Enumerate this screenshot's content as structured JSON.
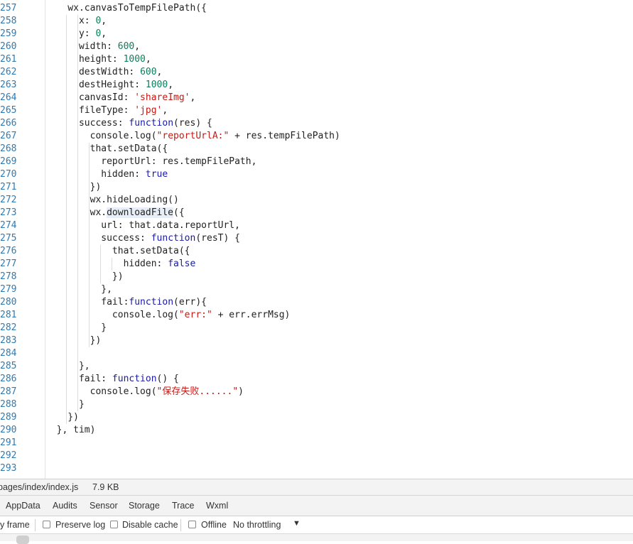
{
  "editor": {
    "line_numbers": [
      "257",
      "258",
      "259",
      "260",
      "261",
      "262",
      "263",
      "264",
      "265",
      "266",
      "267",
      "268",
      "269",
      "270",
      "271",
      "272",
      "273",
      "274",
      "275",
      "276",
      "277",
      "278",
      "279",
      "280",
      "281",
      "282",
      "283",
      "284",
      "285",
      "286",
      "287",
      "288",
      "289",
      "290",
      "291",
      "292",
      "293"
    ],
    "code_lines": [
      [
        {
          "t": "    wx.canvasToTempFilePath({"
        }
      ],
      [
        {
          "t": "      x: "
        },
        {
          "t": "0",
          "c": "num"
        },
        {
          "t": ","
        }
      ],
      [
        {
          "t": "      y: "
        },
        {
          "t": "0",
          "c": "num"
        },
        {
          "t": ","
        }
      ],
      [
        {
          "t": "      width: "
        },
        {
          "t": "600",
          "c": "num"
        },
        {
          "t": ","
        }
      ],
      [
        {
          "t": "      height: "
        },
        {
          "t": "1000",
          "c": "num"
        },
        {
          "t": ","
        }
      ],
      [
        {
          "t": "      destWidth: "
        },
        {
          "t": "600",
          "c": "num"
        },
        {
          "t": ","
        }
      ],
      [
        {
          "t": "      destHeight: "
        },
        {
          "t": "1000",
          "c": "num"
        },
        {
          "t": ","
        }
      ],
      [
        {
          "t": "      canvasId: "
        },
        {
          "t": "'shareImg'",
          "c": "str"
        },
        {
          "t": ","
        }
      ],
      [
        {
          "t": "      fileType: "
        },
        {
          "t": "'jpg'",
          "c": "str"
        },
        {
          "t": ","
        }
      ],
      [
        {
          "t": "      success: "
        },
        {
          "t": "function",
          "c": "kw"
        },
        {
          "t": "(res) {"
        }
      ],
      [
        {
          "t": "        console.log("
        },
        {
          "t": "\"reportUrlA:\"",
          "c": "str"
        },
        {
          "t": " + res.tempFilePath)"
        }
      ],
      [
        {
          "t": "        that.setData({"
        }
      ],
      [
        {
          "t": "          reportUrl: res.tempFilePath,"
        }
      ],
      [
        {
          "t": "          hidden: "
        },
        {
          "t": "true",
          "c": "kw"
        }
      ],
      [
        {
          "t": "        })"
        }
      ],
      [
        {
          "t": "        wx.hideLoading()"
        }
      ],
      [
        {
          "t": "        wx."
        },
        {
          "t": "downloadFile",
          "c": "hl"
        },
        {
          "t": "({"
        }
      ],
      [
        {
          "t": "          url: that.data.reportUrl,"
        }
      ],
      [
        {
          "t": "          success: "
        },
        {
          "t": "function",
          "c": "kw"
        },
        {
          "t": "(resT) {"
        }
      ],
      [
        {
          "t": "            that.setData({"
        }
      ],
      [
        {
          "t": "              hidden: "
        },
        {
          "t": "false",
          "c": "kw"
        }
      ],
      [
        {
          "t": "            })"
        }
      ],
      [
        {
          "t": "          },"
        }
      ],
      [
        {
          "t": "          fail:"
        },
        {
          "t": "function",
          "c": "kw"
        },
        {
          "t": "(err){"
        }
      ],
      [
        {
          "t": "            console.log("
        },
        {
          "t": "\"err:\"",
          "c": "str"
        },
        {
          "t": " + err.errMsg)"
        }
      ],
      [
        {
          "t": "          }"
        }
      ],
      [
        {
          "t": "        })"
        }
      ],
      [
        {
          "t": ""
        }
      ],
      [
        {
          "t": "      },"
        }
      ],
      [
        {
          "t": "      fail: "
        },
        {
          "t": "function",
          "c": "kw"
        },
        {
          "t": "() {"
        }
      ],
      [
        {
          "t": "        console.log("
        },
        {
          "t": "\"保存失败......\"",
          "c": "str"
        },
        {
          "t": ")"
        }
      ],
      [
        {
          "t": "      }"
        }
      ],
      [
        {
          "t": "    })"
        }
      ],
      [
        {
          "t": "  }, tim)"
        }
      ],
      [
        {
          "t": ""
        }
      ],
      [
        {
          "t": ""
        }
      ],
      [
        {
          "t": ""
        }
      ]
    ]
  },
  "status": {
    "file_path": "pages/index/index.js",
    "file_size": "7.9 KB"
  },
  "tabs": [
    {
      "label": "AppData"
    },
    {
      "label": "Audits"
    },
    {
      "label": "Sensor"
    },
    {
      "label": "Storage"
    },
    {
      "label": "Trace"
    },
    {
      "label": "Wxml"
    }
  ],
  "toolbar": {
    "frame_label": "y frame",
    "preserve_log": "Preserve log",
    "disable_cache": "Disable cache",
    "offline": "Offline",
    "throttling": "No throttling",
    "throttling_caret": "▼"
  },
  "colors": {
    "line_number": "#2c7bb6",
    "keyword": "#1a1aa6",
    "number": "#0a7f5c",
    "string": "#c41a16"
  }
}
